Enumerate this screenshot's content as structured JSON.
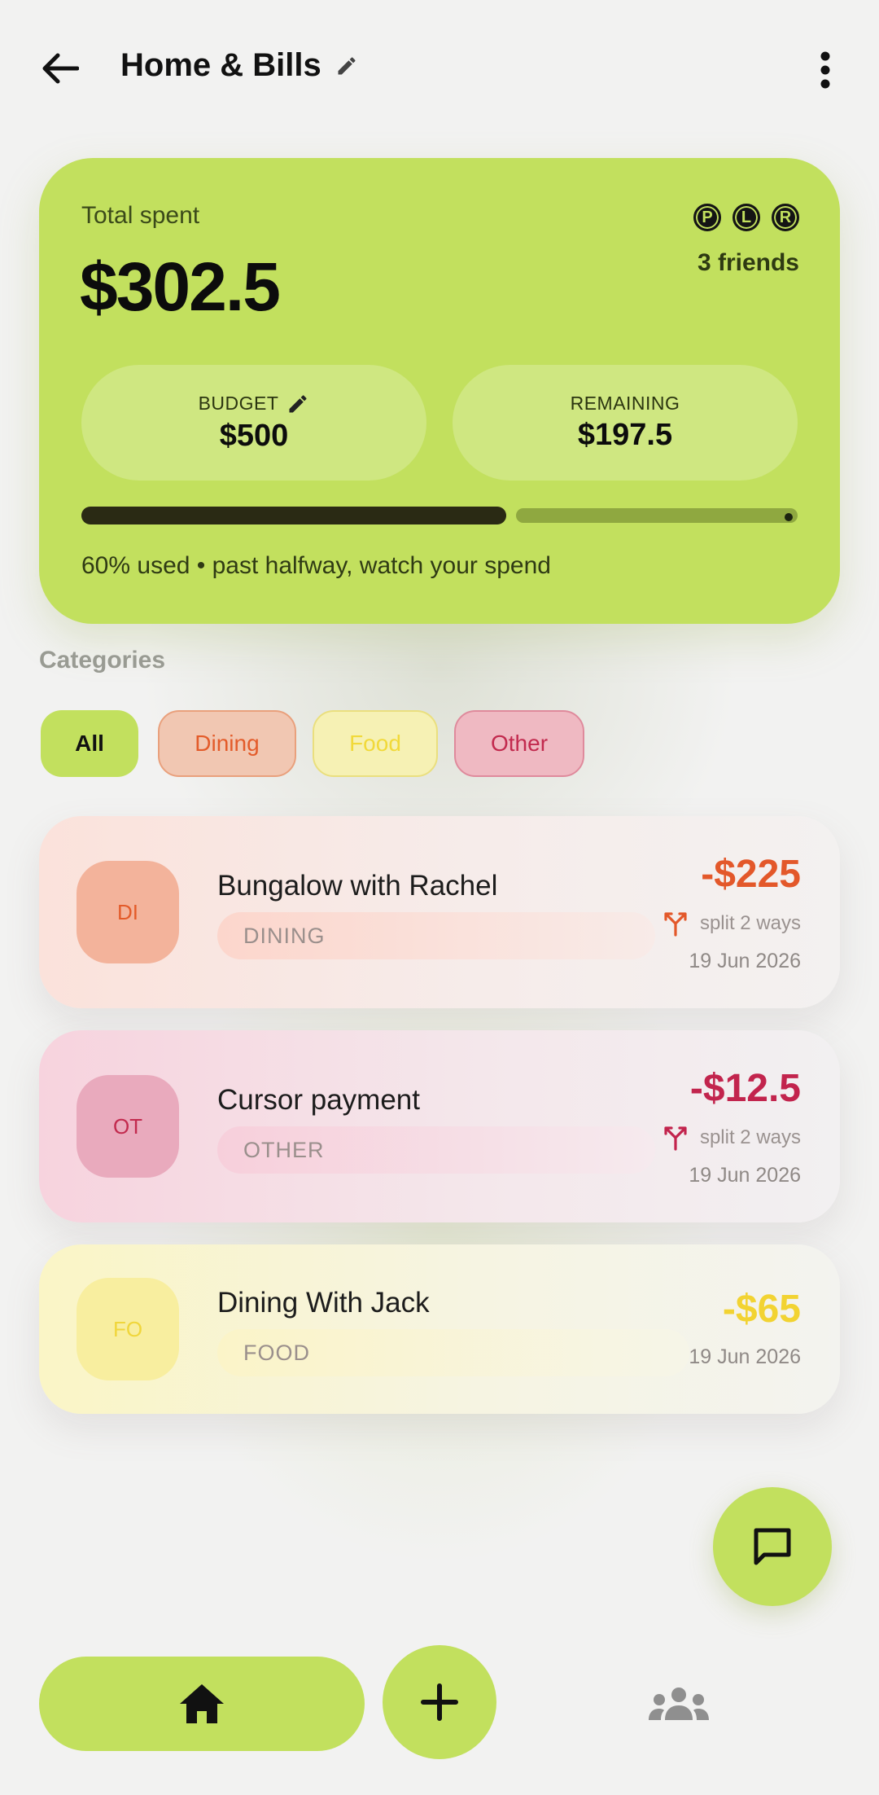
{
  "header": {
    "title": "Home & Bills",
    "back_icon": "arrow-left-icon",
    "edit_icon": "pencil-icon",
    "more_icon": "more-vertical-icon"
  },
  "summary": {
    "total_label": "Total spent",
    "total_amount": "$302.5",
    "avatars": [
      "P",
      "L",
      "R"
    ],
    "friends_count": "3 friends",
    "budget_label": "BUDGET",
    "budget_value": "$500",
    "remaining_label": "REMAINING",
    "remaining_value": "$197.5",
    "used_fraction": 0.6,
    "caption": "60% used • past halfway, watch your spend",
    "accent_color": "#c2e05e"
  },
  "categories": {
    "heading": "Categories",
    "chips": [
      {
        "label": "All",
        "selected": true
      },
      {
        "label": "Dining",
        "selected": false
      },
      {
        "label": "Food",
        "selected": false
      },
      {
        "label": "Other",
        "selected": false
      }
    ]
  },
  "expenses": [
    {
      "initials": "DI",
      "name": "Bungalow with Rachel",
      "tag": "DINING",
      "amount": "-$225",
      "split": "split 2 ways",
      "date": "19 Jun 2026",
      "color": "#e3582a"
    },
    {
      "initials": "OT",
      "name": "Cursor payment",
      "tag": "OTHER",
      "amount": "-$12.5",
      "split": "split 2 ways",
      "date": "19 Jun 2026",
      "color": "#c2244d"
    },
    {
      "initials": "FO",
      "name": "Dining With Jack",
      "tag": "FOOD",
      "amount": "-$65",
      "date": "19 Jun 2026",
      "color": "#f2d332"
    }
  ],
  "fab": {
    "icon": "chat-icon"
  },
  "nav": {
    "home_icon": "home-icon",
    "add_icon": "plus-icon",
    "friends_icon": "group-icon"
  }
}
